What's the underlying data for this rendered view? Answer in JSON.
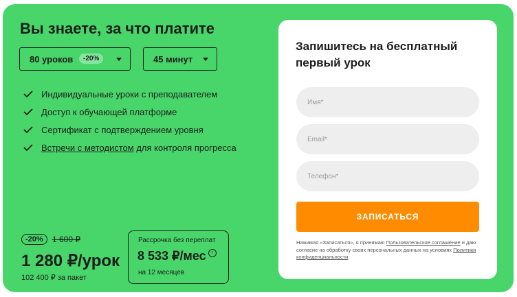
{
  "pricing": {
    "title": "Вы знаете, за что платите",
    "lessons_select": {
      "value": "80 уроков",
      "discount": "-20%"
    },
    "duration_select": {
      "value": "45 минут"
    },
    "features": [
      {
        "text": "Индивидуальные уроки с преподавателем"
      },
      {
        "text": "Доступ к обучающей платформе"
      },
      {
        "text": "Сертификат с подтверждением уровня"
      },
      {
        "link": "Встречи с методистом",
        "text": " для контроля прогресса"
      }
    ],
    "discount_badge": "-20%",
    "old_price": "1 600 ₽",
    "price": "1 280 ₽/урок",
    "package_total": "102 400 ₽ за пакет",
    "installment": {
      "label": "Рассрочка без переплат",
      "amount": "8 533 ₽/мес",
      "info_icon": "i",
      "period": "на 12 месяцев"
    }
  },
  "form": {
    "title": "Запишитесь на бесплатный первый урок",
    "name_placeholder": "Имя*",
    "email_placeholder": "Email*",
    "phone_placeholder": "Телефон*",
    "submit_label": "ЗАПИСАТЬСЯ",
    "legal_prefix": "Нажимая «Записаться», я принимаю ",
    "legal_link1": "Пользовательское соглашение",
    "legal_middle": " и даю согласие на обработку своих персональных данных на условиях ",
    "legal_link2": "Политики конфиденциальности"
  },
  "colors": {
    "background_green": "#48d66a",
    "accent_orange": "#ff8c00",
    "field_gray": "#eeeeee"
  },
  "icons": {
    "check": "check-icon",
    "caret": "chevron-down-icon",
    "info": "info-icon"
  }
}
